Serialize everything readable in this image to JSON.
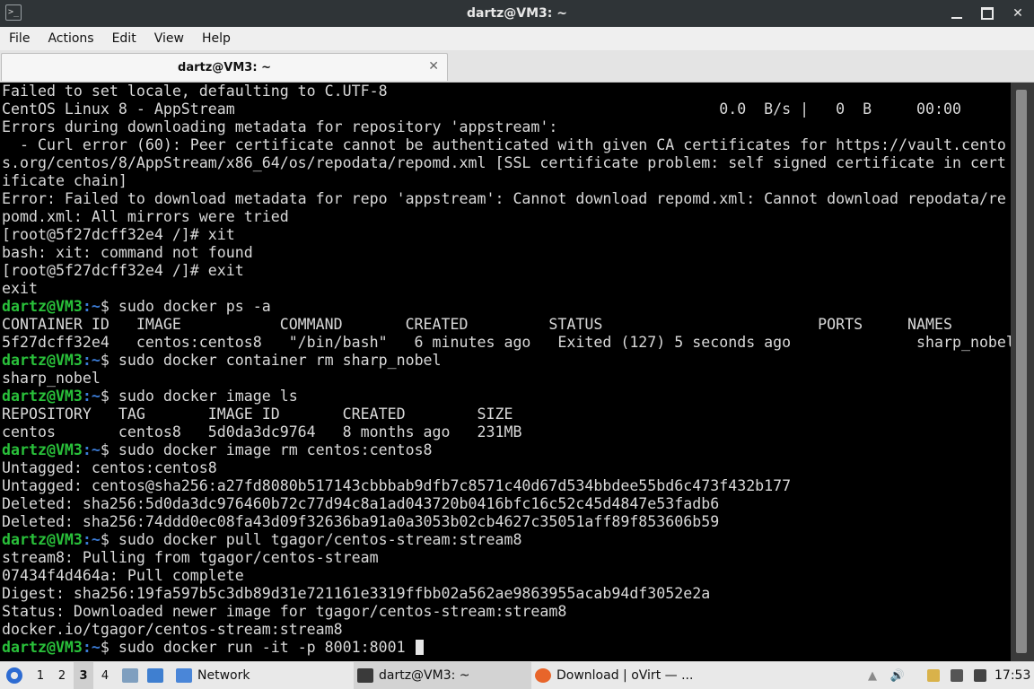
{
  "window": {
    "title": "dartz@VM3: ~",
    "app_icon_glyph": ">_",
    "close_glyph": "✕"
  },
  "menu": [
    "File",
    "Actions",
    "Edit",
    "View",
    "Help"
  ],
  "tab": {
    "label": "dartz@VM3: ~",
    "close_glyph": "✕"
  },
  "terminal": {
    "colors": {
      "text": "#d9d9d9",
      "prompt_user": "#29c03a",
      "prompt_path": "#3b7bd4",
      "background": "#000000"
    },
    "lines": [
      {
        "text": "Failed to set locale, defaulting to C.UTF-8"
      },
      {
        "text": "CentOS Linux 8 - AppStream                                                      0.0  B/s |   0  B     00:00"
      },
      {
        "text": "Errors during downloading metadata for repository 'appstream':"
      },
      {
        "text": "  - Curl error (60): Peer certificate cannot be authenticated with given CA certificates for https://vault.cento"
      },
      {
        "text": "s.org/centos/8/AppStream/x86_64/os/repodata/repomd.xml [SSL certificate problem: self signed certificate in cert"
      },
      {
        "text": "ificate chain]"
      },
      {
        "text": "Error: Failed to download metadata for repo 'appstream': Cannot download repomd.xml: Cannot download repodata/re"
      },
      {
        "text": "pomd.xml: All mirrors were tried"
      },
      {
        "text": "[root@5f27dcff32e4 /]# xit"
      },
      {
        "text": "bash: xit: command not found"
      },
      {
        "text": "[root@5f27dcff32e4 /]# exit"
      },
      {
        "text": "exit"
      },
      {
        "prompt_user": "dartz@VM3",
        "prompt_path": ":~",
        "text": "$ sudo docker ps -a"
      },
      {
        "text": "CONTAINER ID   IMAGE           COMMAND       CREATED         STATUS                        PORTS     NAMES"
      },
      {
        "text": "5f27dcff32e4   centos:centos8   \"/bin/bash\"   6 minutes ago   Exited (127) 5 seconds ago              sharp_nobel"
      },
      {
        "prompt_user": "dartz@VM3",
        "prompt_path": ":~",
        "text": "$ sudo docker container rm sharp_nobel"
      },
      {
        "text": "sharp_nobel"
      },
      {
        "prompt_user": "dartz@VM3",
        "prompt_path": ":~",
        "text": "$ sudo docker image ls"
      },
      {
        "text": "REPOSITORY   TAG       IMAGE ID       CREATED        SIZE"
      },
      {
        "text": "centos       centos8   5d0da3dc9764   8 months ago   231MB"
      },
      {
        "prompt_user": "dartz@VM3",
        "prompt_path": ":~",
        "text": "$ sudo docker image rm centos:centos8"
      },
      {
        "text": "Untagged: centos:centos8"
      },
      {
        "text": "Untagged: centos@sha256:a27fd8080b517143cbbbab9dfb7c8571c40d67d534bbdee55bd6c473f432b177"
      },
      {
        "text": "Deleted: sha256:5d0da3dc976460b72c77d94c8a1ad043720b0416bfc16c52c45d4847e53fadb6"
      },
      {
        "text": "Deleted: sha256:74ddd0ec08fa43d09f32636ba91a0a3053b02cb4627c35051aff89f853606b59"
      },
      {
        "prompt_user": "dartz@VM3",
        "prompt_path": ":~",
        "text": "$ sudo docker pull tgagor/centos-stream:stream8"
      },
      {
        "text": "stream8: Pulling from tgagor/centos-stream"
      },
      {
        "text": "07434f4d464a: Pull complete"
      },
      {
        "text": "Digest: sha256:19fa597b5c3db89d31e721161e3319ffbb02a562ae9863955acab94df3052e2a"
      },
      {
        "text": "Status: Downloaded newer image for tgagor/centos-stream:stream8"
      },
      {
        "text": "docker.io/tgagor/centos-stream:stream8"
      },
      {
        "prompt_user": "dartz@VM3",
        "prompt_path": ":~",
        "text": "$ sudo docker run -it -p 8001:8001 ",
        "cursor": true
      }
    ]
  },
  "taskbar": {
    "workspaces": [
      "1",
      "2",
      "3",
      "4"
    ],
    "active_workspace": 2,
    "launchers": [
      {
        "name": "files-icon",
        "color": "#7f9fbf"
      },
      {
        "name": "desktop-icon",
        "color": "#3f7fd0"
      }
    ],
    "tasks": [
      {
        "name": "taskbar-network",
        "label": "Network",
        "icon": "folder-icon",
        "icon_color": "#4a86d8",
        "active": false
      },
      {
        "name": "taskbar-terminal",
        "label": "dartz@VM3: ~",
        "icon": "terminal-icon",
        "icon_color": "#3a3a3a",
        "active": true
      },
      {
        "name": "taskbar-firefox",
        "label": "Download | oVirt — ...",
        "icon": "firefox-icon",
        "icon_color": "#e8652a",
        "active": false
      }
    ],
    "clock": "17:53"
  }
}
